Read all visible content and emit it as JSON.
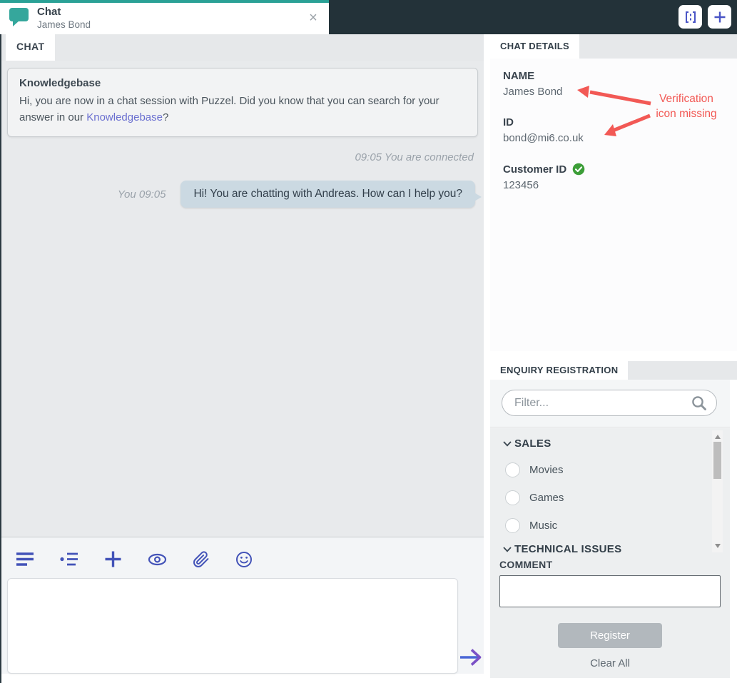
{
  "app": {
    "window_tab": {
      "title": "Chat",
      "subtitle": "James Bond"
    },
    "close_glyph": "×",
    "colors": {
      "accent_teal": "#2aa196",
      "header_bg": "#233239",
      "toolbar_icon": "#4353c0",
      "annotation_red": "#f25955",
      "verified_green": "#3c9e38",
      "bubble": "#cbd9e2",
      "link": "#6a6fd0"
    },
    "header_actions": [
      {
        "icon": "split-view-icon"
      },
      {
        "icon": "new-tab-plus-icon"
      }
    ]
  },
  "chat": {
    "tab_label": "CHAT",
    "knowledgebase": {
      "title": "Knowledgebase",
      "text_before": "Hi, you are now in a chat session with Puzzel. Did you know that you can search for your answer in our ",
      "link_text": "Knowledgebase",
      "text_after": "?"
    },
    "status_line": "09:05 You are connected",
    "message": {
      "meta": "You 09:05",
      "text": "Hi! You are chatting with Andreas. How can I help you?"
    },
    "composer": {
      "value": "",
      "toolbar_icons": [
        "align-left-icon",
        "list-icon",
        "plus-icon",
        "preview-eye-icon",
        "attachment-icon",
        "emoji-icon"
      ],
      "send_icon": "arrow-right-icon"
    }
  },
  "chat_details": {
    "tab_label": "CHAT DETAILS",
    "fields": [
      {
        "label": "NAME",
        "value": "James Bond"
      },
      {
        "label": "ID",
        "value": "bond@mi6.co.uk"
      },
      {
        "label": "Customer ID",
        "value": "123456",
        "verified_icon": "verified-check-icon"
      }
    ],
    "annotation": {
      "text": "Verification icon missing"
    }
  },
  "enquiry": {
    "tab_label": "ENQUIRY REGISTRATION",
    "filter_placeholder": "Filter...",
    "search_icon": "search-icon",
    "groups": [
      {
        "name": "SALES",
        "options": [
          "Movies",
          "Games",
          "Music"
        ]
      },
      {
        "name": "TECHNICAL ISSUES",
        "options": []
      }
    ],
    "comment": {
      "label": "COMMENT",
      "value": ""
    },
    "register_label": "Register",
    "clear_all_label": "Clear All"
  }
}
